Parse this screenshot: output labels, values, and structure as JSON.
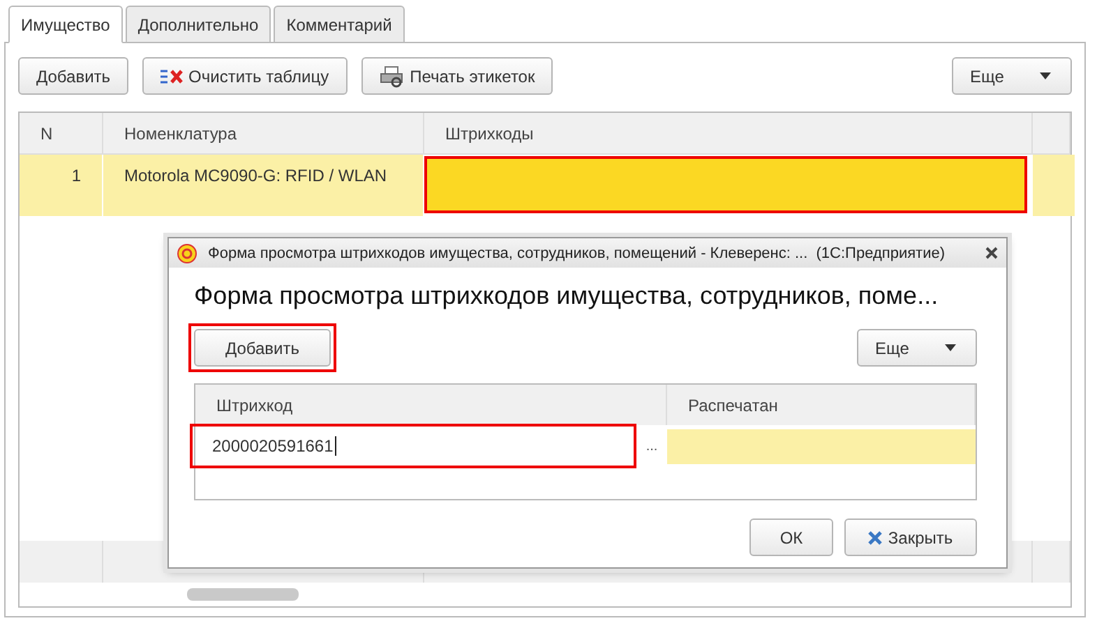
{
  "tabs": [
    {
      "label": "Имущество",
      "selected": true
    },
    {
      "label": "Дополнительно",
      "selected": false
    },
    {
      "label": "Комментарий",
      "selected": false
    }
  ],
  "toolbar": {
    "buttons": [
      {
        "label": "Добавить",
        "kind": "plain"
      },
      {
        "label": "Очистить таблицу",
        "kind": "clear"
      },
      {
        "label": "Печать этикеток",
        "kind": "print"
      }
    ],
    "more": "Еще"
  },
  "table": {
    "columns": [
      "N",
      "Номенклатура",
      "Штрихкоды"
    ],
    "rows": [
      {
        "n": "1",
        "name": "Motorola MC9090-G: RFID / WLAN",
        "barcodes": "",
        "selected": true,
        "highlighted": true
      }
    ]
  },
  "dialog": {
    "window_title": "Форма просмотра штрихкодов имущества, сотрудников, помещений - Клеверенс: ...  (1С:Предприятие)",
    "heading": "Форма просмотра штрихкодов имущества, сотрудников, поме...",
    "add_button": {
      "label": "Добавить",
      "highlighted": true
    },
    "more": "Еще",
    "grid": {
      "columns": [
        "Штрихкод",
        "Распечатан"
      ],
      "rows": [
        {
          "barcode": "2000020591661",
          "picker": "...",
          "printed": "",
          "selected": true,
          "highlighted": true
        }
      ]
    },
    "ok": "ОК",
    "close": "Закрыть"
  }
}
